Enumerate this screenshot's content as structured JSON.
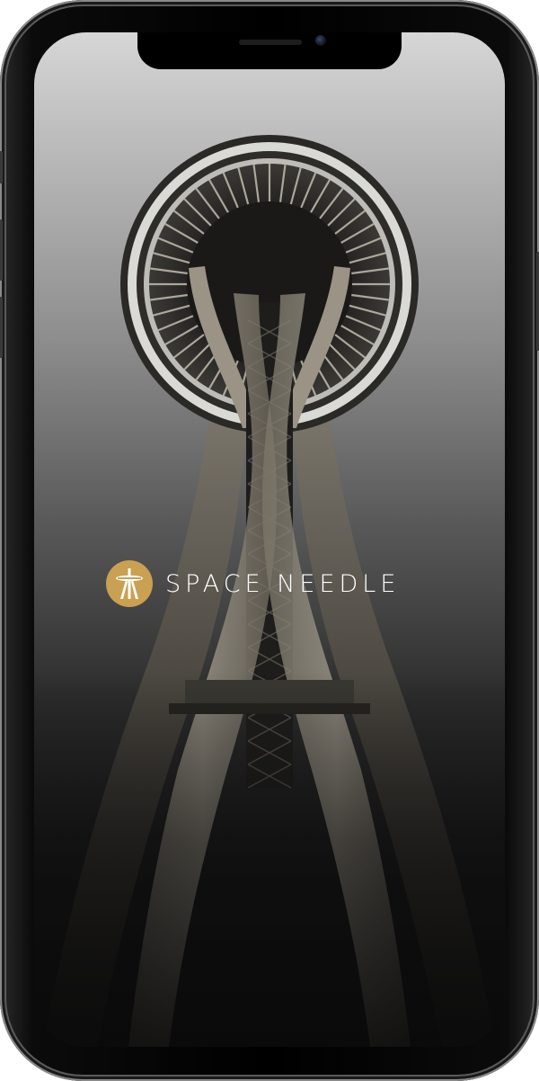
{
  "device": {
    "frame_color": "#000000",
    "bezel_highlight": "#8a8a8a"
  },
  "splash": {
    "brand_name": "SPACE NEEDLE",
    "brand_color": "#caa052",
    "logo_icon": "space-needle-icon",
    "background_image": "space-needle-tower-photo"
  }
}
